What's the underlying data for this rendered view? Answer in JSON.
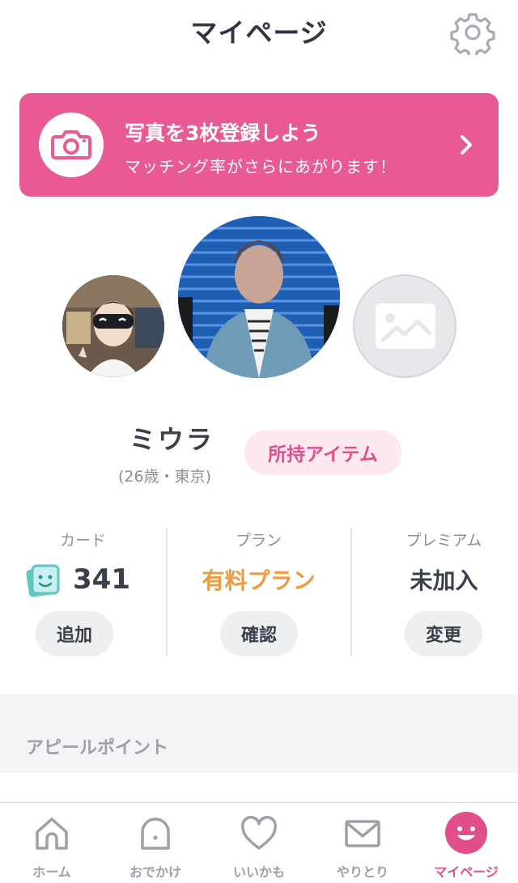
{
  "header": {
    "title": "マイページ",
    "settings_icon": "gear-icon"
  },
  "banner": {
    "title": "写真を3枚登録しよう",
    "subtitle": "マッチング率がさらにあがります！",
    "icon": "camera-icon",
    "chevron": "chevron-right-icon",
    "color": "#e95a94"
  },
  "photos": {
    "left": "profile-photo-2",
    "main": "profile-photo-main",
    "empty": "empty-photo-placeholder"
  },
  "profile": {
    "name": "ミウラ",
    "meta": "(26歳・東京)",
    "items_button": "所持アイテム"
  },
  "stats": {
    "card": {
      "label": "カード",
      "value": "341",
      "button": "追加",
      "icon": "card-icon"
    },
    "plan": {
      "label": "プラン",
      "value": "有料プラン",
      "button": "確認",
      "value_color": "#f39a3c"
    },
    "premium": {
      "label": "プレミアム",
      "value": "未加入",
      "button": "変更"
    }
  },
  "section": {
    "title": "アピールポイント"
  },
  "tabbar": {
    "tabs": [
      {
        "label": "ホーム",
        "icon": "home-icon"
      },
      {
        "label": "おでかけ",
        "icon": "ghost-icon"
      },
      {
        "label": "いいかも",
        "icon": "heart-icon"
      },
      {
        "label": "やりとり",
        "icon": "mail-icon"
      },
      {
        "label": "マイページ",
        "icon": "smiley-icon",
        "active": true
      }
    ],
    "accent": "#e24e8a"
  }
}
